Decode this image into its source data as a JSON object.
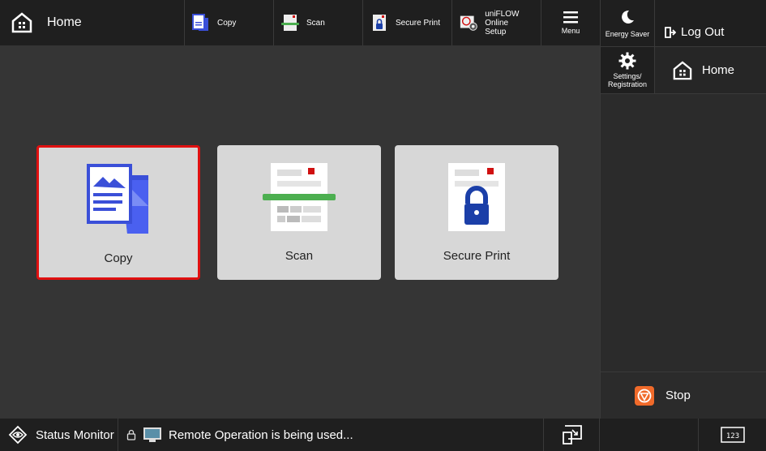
{
  "topbar": {
    "home_label": "Home",
    "shortcuts": [
      {
        "label": "Copy",
        "icon": "copy-icon"
      },
      {
        "label": "Scan",
        "icon": "scan-icon"
      },
      {
        "label": "Secure Print",
        "icon": "secure-print-icon"
      },
      {
        "label_line1": "uniFLOW Online",
        "label_line2": "Setup",
        "icon": "uniflow-setup-icon"
      }
    ],
    "menu_label": "Menu"
  },
  "main": {
    "tiles": [
      {
        "label": "Copy",
        "icon": "copy-icon",
        "selected": true
      },
      {
        "label": "Scan",
        "icon": "scan-icon",
        "selected": false
      },
      {
        "label": "Secure Print",
        "icon": "secure-print-icon",
        "selected": false
      }
    ]
  },
  "right_panel": {
    "energy_saver_label": "Energy Saver",
    "logout_label": "Log Out",
    "settings_label_line1": "Settings/",
    "settings_label_line2": "Registration",
    "home_label": "Home",
    "stop_label": "Stop"
  },
  "bottombar": {
    "status_monitor_label": "Status Monitor",
    "message": "Remote Operation is being used...",
    "counter_label": "123"
  },
  "colors": {
    "selection_border": "#e01010",
    "stop_orange": "#f06a2a",
    "icon_blue": "#3a4fd8",
    "scan_green": "#4caf50"
  }
}
